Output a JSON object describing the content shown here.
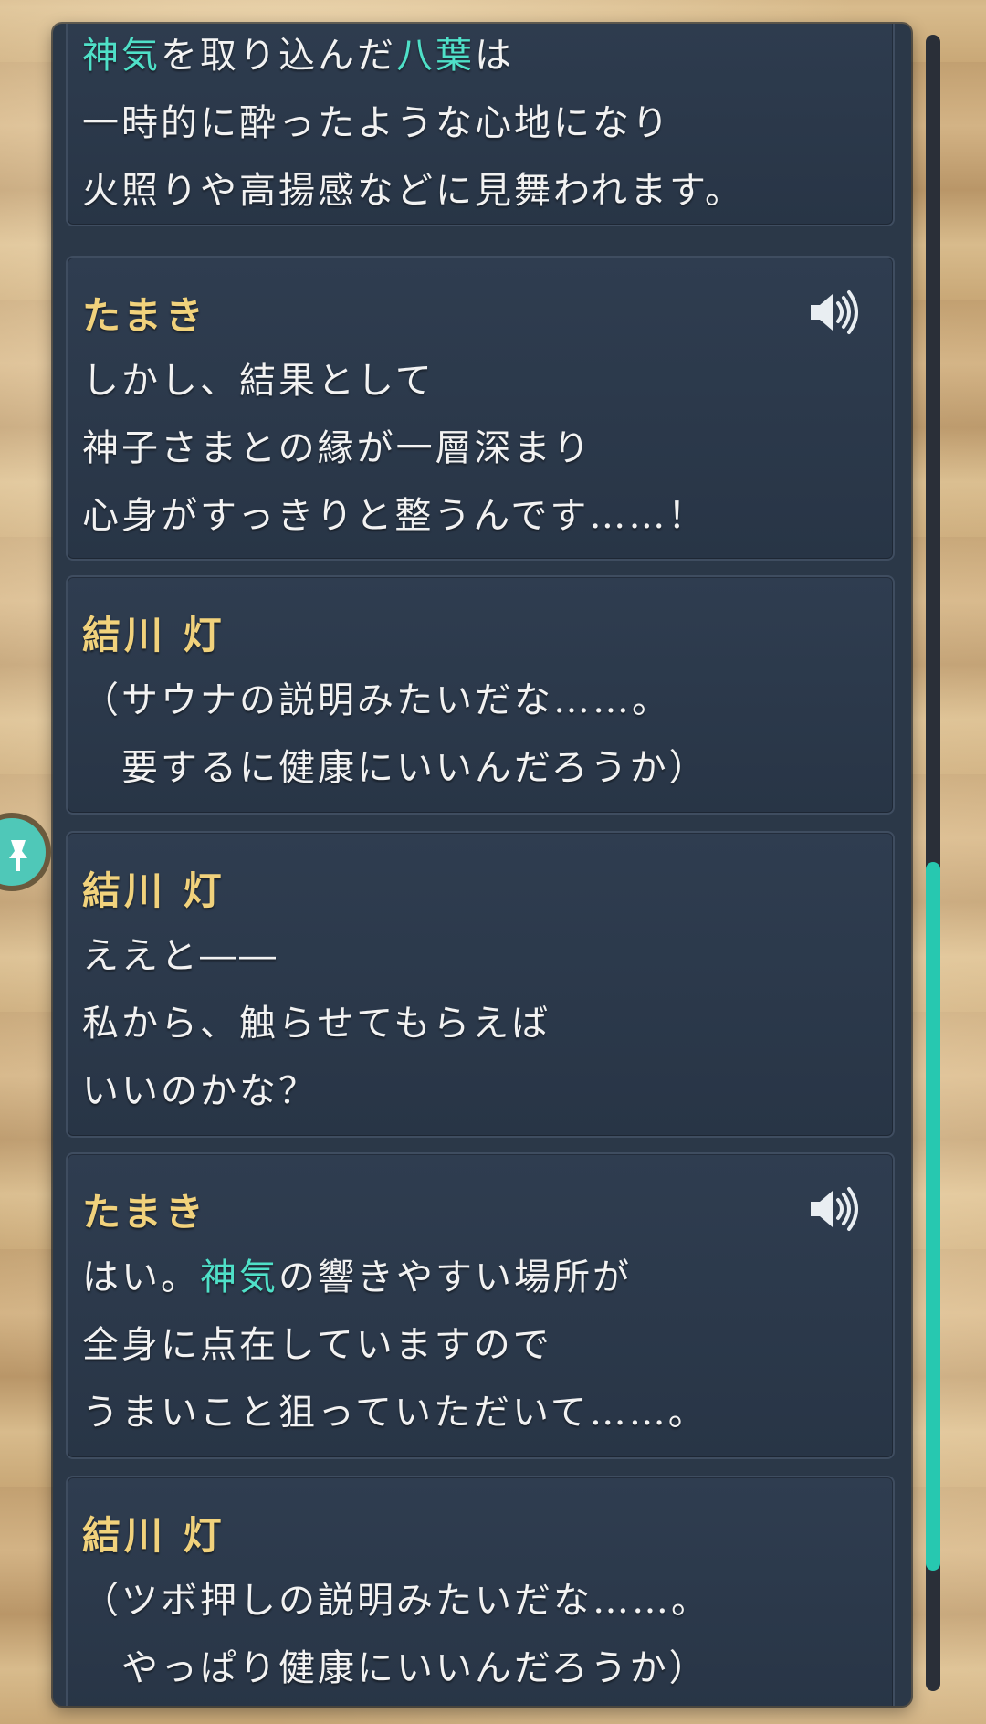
{
  "colors": {
    "accent": "#27c8b0",
    "highlight_text": "#4fe0c8",
    "speaker_name": "#f1d27c",
    "panel_bg": "#2b3848"
  },
  "log": {
    "entries": [
      {
        "speaker": "",
        "has_voice": false,
        "lines": [
          {
            "segments": [
              {
                "text": "神気",
                "hl": true
              },
              {
                "text": "を取り込んだ",
                "hl": false
              },
              {
                "text": "八葉",
                "hl": true
              },
              {
                "text": "は",
                "hl": false
              }
            ]
          },
          {
            "segments": [
              {
                "text": "一時的に酔ったような心地になり",
                "hl": false
              }
            ]
          },
          {
            "segments": [
              {
                "text": "火照りや高揚感などに見舞われます。",
                "hl": false
              }
            ]
          }
        ]
      },
      {
        "speaker": "たまき",
        "has_voice": true,
        "lines": [
          {
            "segments": [
              {
                "text": "しかし、結果として",
                "hl": false
              }
            ]
          },
          {
            "segments": [
              {
                "text": "神子さまとの縁が一層深まり",
                "hl": false
              }
            ]
          },
          {
            "segments": [
              {
                "text": "心身がすっきりと整うんです……！",
                "hl": false
              }
            ]
          }
        ]
      },
      {
        "speaker": "結川 灯",
        "has_voice": false,
        "lines": [
          {
            "segments": [
              {
                "text": "（サウナの説明みたいだな……。",
                "hl": false
              }
            ]
          },
          {
            "segments": [
              {
                "text": "　要するに健康にいいんだろうか）",
                "hl": false
              }
            ]
          }
        ]
      },
      {
        "speaker": "結川 灯",
        "has_voice": false,
        "lines": [
          {
            "segments": [
              {
                "text": "ええと――",
                "hl": false
              }
            ]
          },
          {
            "segments": [
              {
                "text": "私から、触らせてもらえば",
                "hl": false
              }
            ]
          },
          {
            "segments": [
              {
                "text": "いいのかな？",
                "hl": false
              }
            ]
          }
        ]
      },
      {
        "speaker": "たまき",
        "has_voice": true,
        "lines": [
          {
            "segments": [
              {
                "text": "はい。",
                "hl": false
              },
              {
                "text": "神気",
                "hl": true
              },
              {
                "text": "の響きやすい場所が",
                "hl": false
              }
            ]
          },
          {
            "segments": [
              {
                "text": "全身に点在していますので",
                "hl": false
              }
            ]
          },
          {
            "segments": [
              {
                "text": "うまいこと狙っていただいて……。",
                "hl": false
              }
            ]
          }
        ]
      },
      {
        "speaker": "結川 灯",
        "has_voice": false,
        "lines": [
          {
            "segments": [
              {
                "text": "（ツボ押しの説明みたいだな……。",
                "hl": false
              }
            ]
          },
          {
            "segments": [
              {
                "text": "　やっぱり健康にいいんだろうか）",
                "hl": false
              }
            ]
          }
        ]
      }
    ]
  },
  "scroll": {
    "position_fraction": 0.5,
    "visible_fraction": 0.43
  },
  "icons": {
    "voice": "speaker-volume-icon",
    "side_tab": "pin-icon"
  }
}
